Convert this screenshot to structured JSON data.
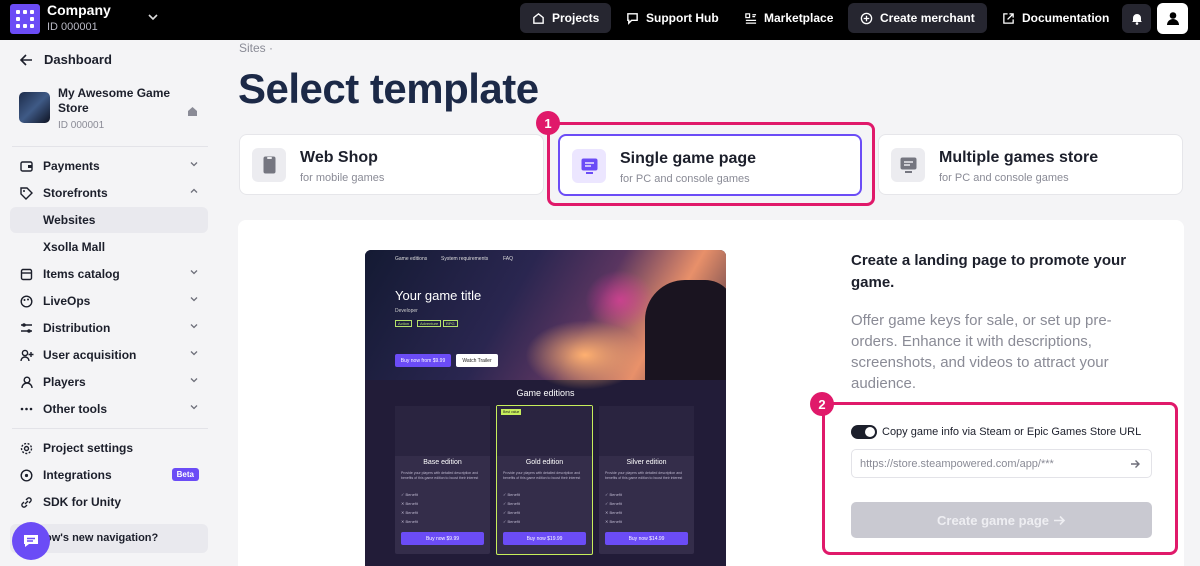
{
  "topbar": {
    "company_name": "Company",
    "company_id": "ID 000001",
    "nav": {
      "projects": "Projects",
      "support": "Support Hub",
      "marketplace": "Marketplace",
      "create_merchant": "Create merchant",
      "documentation": "Documentation"
    }
  },
  "sidebar": {
    "dashboard": "Dashboard",
    "store": {
      "name": "My Awesome Game Store",
      "id": "ID 000001"
    },
    "items": [
      {
        "label": "Payments"
      },
      {
        "label": "Storefronts"
      },
      {
        "label": "Websites"
      },
      {
        "label": "Xsolla Mall"
      },
      {
        "label": "Items catalog"
      },
      {
        "label": "LiveOps"
      },
      {
        "label": "Distribution"
      },
      {
        "label": "User acquisition"
      },
      {
        "label": "Players"
      },
      {
        "label": "Other tools"
      },
      {
        "label": "Project settings"
      },
      {
        "label": "Integrations",
        "badge": "Beta"
      },
      {
        "label": "SDK for Unity"
      }
    ],
    "whats_new": "ow's new navigation?"
  },
  "main": {
    "breadcrumb": "Sites",
    "title": "Select template",
    "templates": [
      {
        "name": "Web Shop",
        "sub": "for mobile games"
      },
      {
        "name": "Single game page",
        "sub": "for PC and console games"
      },
      {
        "name": "Multiple games store",
        "sub": "for PC and console games"
      }
    ],
    "preview": {
      "nav": [
        "Game editions",
        "System requirements",
        "FAQ"
      ],
      "game_title": "Your game title",
      "developer": "Developer",
      "tags": [
        "Action",
        "Adventure",
        "RPG"
      ],
      "buy_btn": "Buy now from $9.99",
      "trailer_btn": "Watch Trailer",
      "editions_title": "Game editions",
      "best_value": "Best value",
      "edition_desc": "Provide your players with detailed description and benefits of this game edition to boost their interest",
      "benefit": "Benefit",
      "editions": [
        {
          "name": "Base edition",
          "buy": "Buy now $9.99"
        },
        {
          "name": "Gold edition",
          "buy": "Buy now $19.99"
        },
        {
          "name": "Silver edition",
          "buy": "Buy now $14.99"
        }
      ]
    },
    "description_heading": "Create a landing page to promote your game.",
    "description_text": "Offer game keys for sale, or set up pre-orders. Enhance it with descriptions, screenshots, and videos to attract your audience.",
    "copy_toggle_label": "Copy game info via Steam or Epic Games Store URL",
    "url_placeholder": "https://store.steampowered.com/app/***",
    "create_button": "Create game page",
    "annotations": [
      "1",
      "2"
    ]
  },
  "colors": {
    "accent": "#6b4cf6",
    "highlight": "#e0196a"
  }
}
